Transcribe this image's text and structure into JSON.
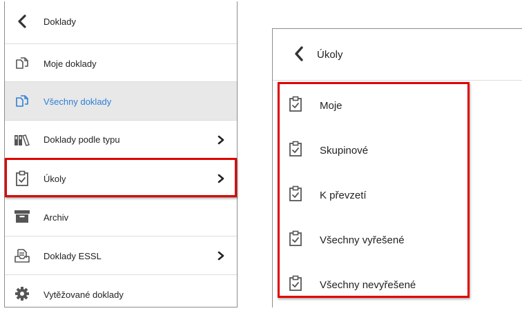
{
  "left_panel": {
    "header": {
      "label": "Doklady",
      "icon": "chevron-left-icon"
    },
    "items": [
      {
        "label": "Moje doklady",
        "icon": "documents-icon",
        "has_submenu": false,
        "active": false
      },
      {
        "label": "Všechny doklady",
        "icon": "documents-icon",
        "has_submenu": false,
        "active": true
      },
      {
        "label": "Doklady podle typu",
        "icon": "binders-icon",
        "has_submenu": true,
        "active": false
      },
      {
        "label": "Úkoly",
        "icon": "clipboard-check-icon",
        "has_submenu": true,
        "active": false,
        "highlighted": true
      },
      {
        "label": "Archiv",
        "icon": "archive-box-icon",
        "has_submenu": false,
        "active": false
      },
      {
        "label": "Doklady ESSL",
        "icon": "inbox-docs-icon",
        "has_submenu": true,
        "active": false
      },
      {
        "label": "Vytěžované doklady",
        "icon": "gear-icon",
        "has_submenu": false,
        "active": false
      }
    ]
  },
  "right_panel": {
    "header": {
      "title": "Úkoly",
      "icon": "chevron-left-icon"
    },
    "items": [
      {
        "label": "Moje",
        "icon": "clipboard-check-icon"
      },
      {
        "label": "Skupinové",
        "icon": "clipboard-check-icon"
      },
      {
        "label": "K převzetí",
        "icon": "clipboard-check-icon"
      },
      {
        "label": "Všechny vyřešené",
        "icon": "clipboard-check-icon"
      },
      {
        "label": "Všechny nevyřešené",
        "icon": "clipboard-check-icon"
      }
    ],
    "highlighted": true
  },
  "colors": {
    "active_text": "#2e7fd6",
    "active_background": "#e8e8e8",
    "highlight_border": "#e00000",
    "icon": "#555555"
  }
}
